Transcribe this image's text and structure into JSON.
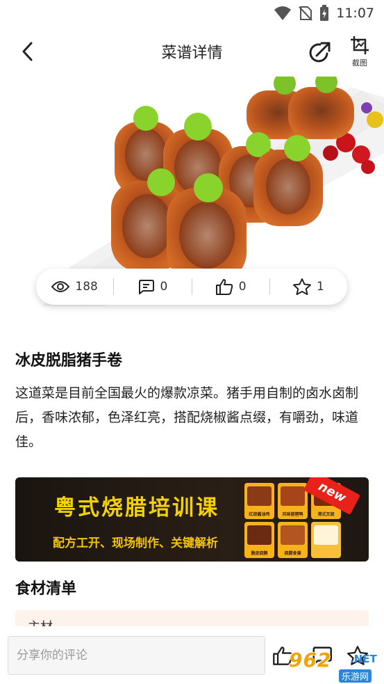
{
  "status_bar": {
    "time": "11:07",
    "icons": [
      "wifi-icon",
      "no-sim-icon",
      "battery-charging-icon"
    ]
  },
  "nav": {
    "title": "菜谱详情",
    "back_icon": "chevron-left-icon",
    "share_icon": "share-icon",
    "screenshot_label": "截图"
  },
  "stats": {
    "views": "188",
    "comments": "0",
    "likes": "0",
    "favorites": "1"
  },
  "dish": {
    "title": "冰皮脱脂猪手卷",
    "description": "这道菜是目前全国最火的爆款凉菜。猪手用自制的卤水卤制后，香味浓郁，色泽红亮，搭配烧椒酱点缀，有嚼劲，味道佳。"
  },
  "banner": {
    "title": "粤式烧腊培训课",
    "subtitle": "配方工开、现场制作、关键解析",
    "badge": "new",
    "thumbnails": [
      "红烧酱油鸡",
      "风味琵琶鸭",
      "港式叉烧",
      "脆皮烧鹅",
      "烧腊食谱"
    ]
  },
  "ingredients": {
    "section_title": "食材清单",
    "main_label": "主材"
  },
  "comment_bar": {
    "placeholder": "分享你的评论"
  },
  "watermark": {
    "logo_text": "962",
    "net": ".NET",
    "site": "乐游网"
  },
  "colors": {
    "banner_text": "#f4d200",
    "ingredients_bg": "#fdf3ec",
    "ribbon": "#e8221b"
  }
}
